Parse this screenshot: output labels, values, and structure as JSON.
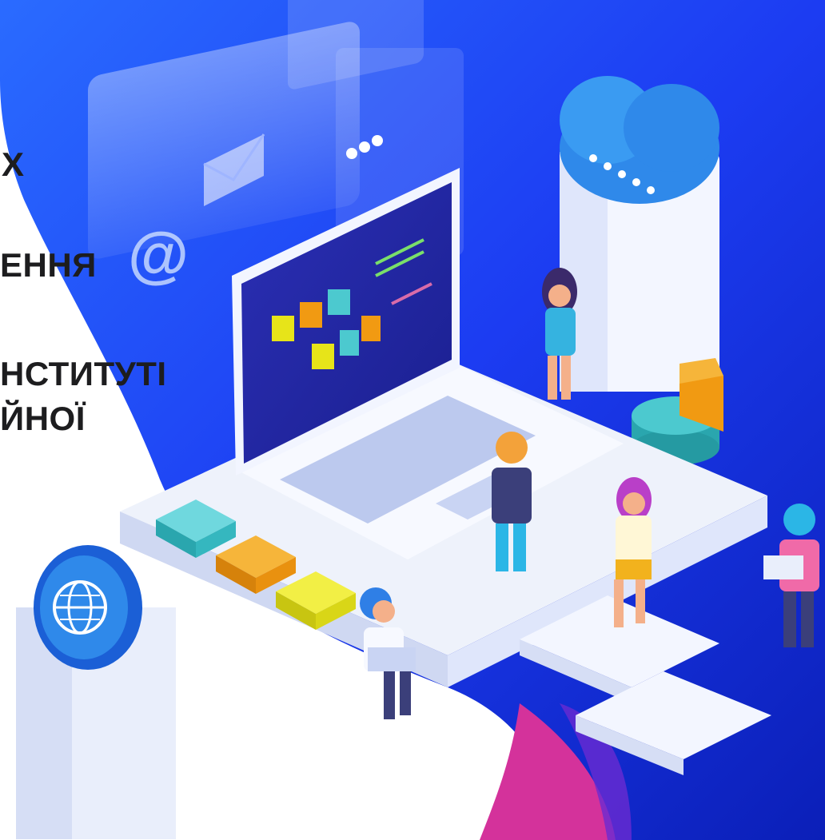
{
  "slide": {
    "title_lines": [
      "Х",
      "ЕННЯ",
      "НСТИТУТІ",
      "ЙНОЇ"
    ]
  },
  "illustration": {
    "email_glyph": "@",
    "colors": {
      "blue_dark": "#0b1fd6",
      "blue_mid": "#1c3cf2",
      "blue_light": "#2a6bff",
      "magenta": "#d4329b",
      "teal_tile": "#49c9cf",
      "orange_tile": "#f19a12",
      "yellow_tile": "#e7e419",
      "platform": "#eef2fb",
      "cloud": "#2f89ea"
    }
  }
}
